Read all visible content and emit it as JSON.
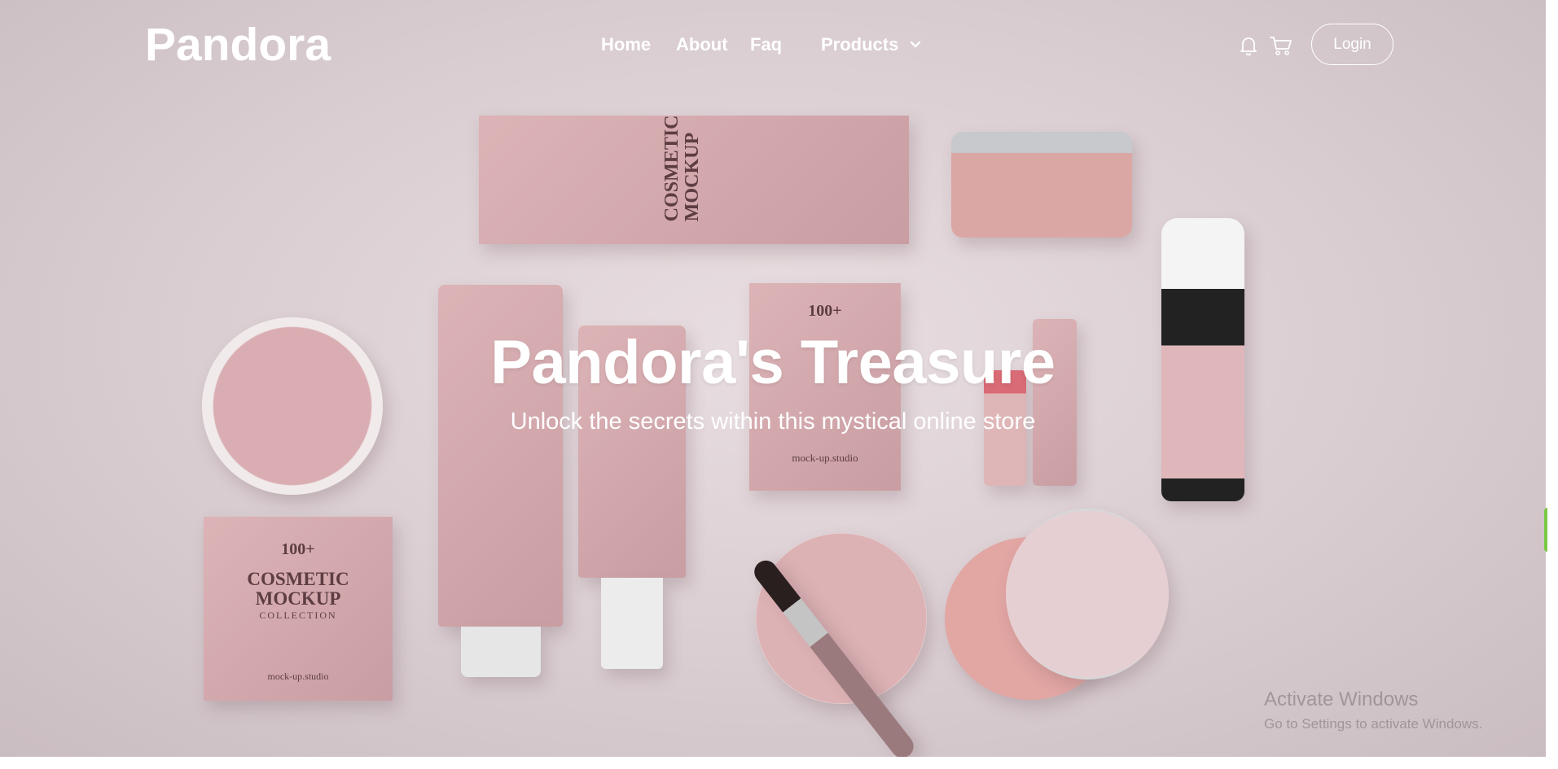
{
  "brand": {
    "logo": "Pandora"
  },
  "nav": {
    "items": [
      {
        "label": "Home"
      },
      {
        "label": "About"
      },
      {
        "label": "Faq"
      },
      {
        "label": "Products"
      }
    ],
    "login_label": "Login"
  },
  "icons": {
    "products_dropdown": "chevron-down-icon",
    "notifications": "bell-icon",
    "cart": "cart-icon"
  },
  "hero": {
    "title": "Pandora's Treasure",
    "subtitle": "Unlock the secrets within this mystical online store",
    "product_label": {
      "count": "100+",
      "name": "COSMETIC MOCKUP",
      "collection": "COLLECTION",
      "brand": "mock-up.studio"
    }
  },
  "watermark": {
    "title": "Activate Windows",
    "subtitle": "Go to Settings to activate Windows."
  },
  "colors": {
    "text": "#ffffff",
    "product_pink": "#d4a9ad"
  }
}
